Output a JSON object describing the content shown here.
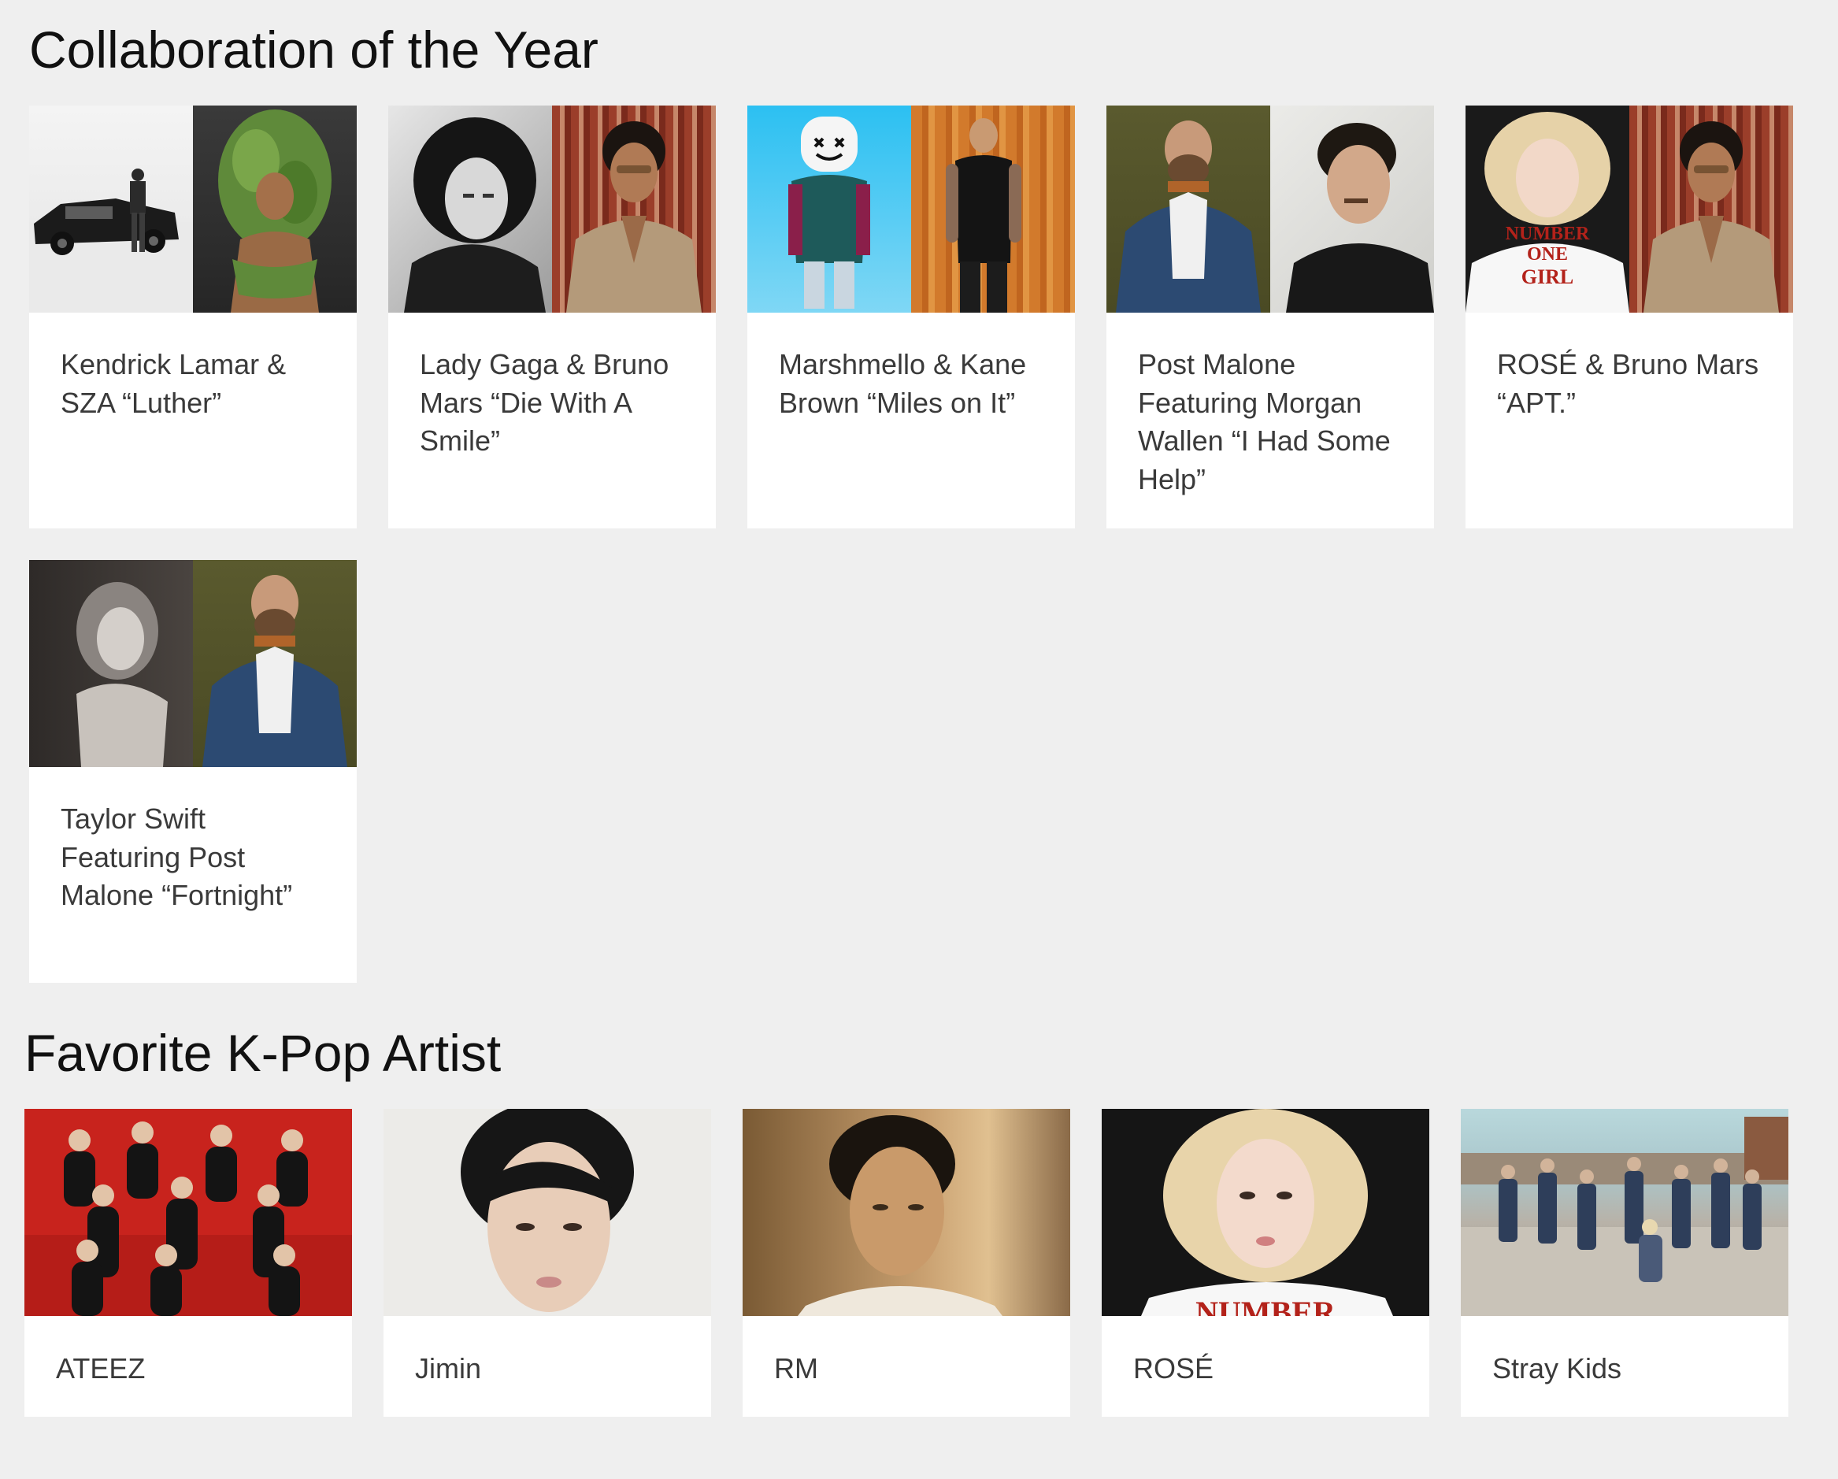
{
  "sections": {
    "collab": {
      "title": "Collaboration of the Year",
      "nominees": [
        {
          "label": "Kendrick Lamar & SZA “Luther”"
        },
        {
          "label": "Lady Gaga & Bruno Mars “Die With A Smile”"
        },
        {
          "label": "Marshmello & Kane Brown “Miles on It”"
        },
        {
          "label": "Post Malone Featuring Morgan Wallen “I Had Some Help”"
        },
        {
          "label": "ROSÉ & Bruno Mars “APT.”"
        },
        {
          "label": "Taylor Swift Featuring Post Malone “Fortnight”"
        }
      ]
    },
    "kpop": {
      "title": "Favorite K-Pop Artist",
      "nominees": [
        {
          "label": "ATEEZ"
        },
        {
          "label": "Jimin"
        },
        {
          "label": "RM"
        },
        {
          "label": "ROSÉ"
        },
        {
          "label": "Stray Kids"
        }
      ]
    }
  },
  "photo_text": {
    "shirt_line_1": "NUMBER",
    "shirt_line_2": "ONE",
    "shirt_line_3": "GIRL",
    "shirt_partial": "NUMBER"
  },
  "colors": {
    "page_bg": "#efefef",
    "card_bg": "#ffffff",
    "title_text": "#111111",
    "card_text": "#3a3a3a",
    "ateez_red": "#c8231d",
    "marshmello_sky": "#3ec4f0",
    "kane_orange": "#d27a2c",
    "olive_backdrop": "#5a5a2e",
    "curtain_red": "#9b3e2a",
    "shirt_red": "#b3221a"
  }
}
